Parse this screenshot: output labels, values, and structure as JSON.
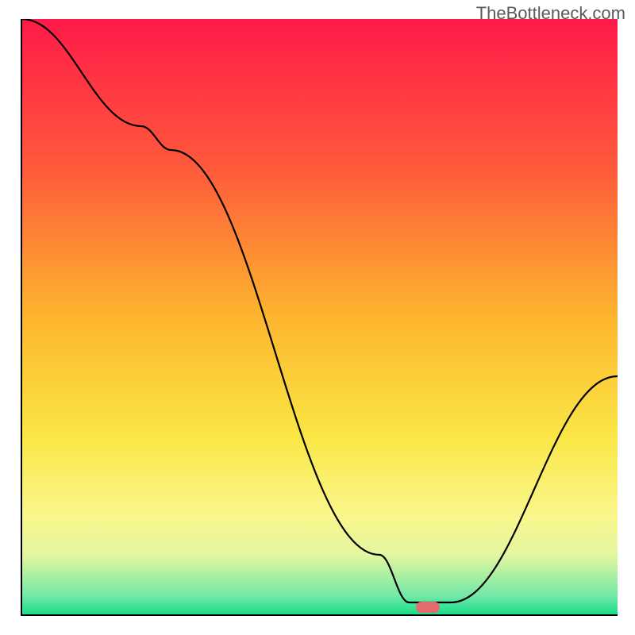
{
  "watermark": "TheBottleneck.com",
  "chart_data": {
    "type": "line",
    "title": "",
    "xlabel": "",
    "ylabel": "",
    "xlim": [
      0,
      100
    ],
    "ylim": [
      0,
      100
    ],
    "x": [
      0,
      20,
      25,
      60,
      65,
      72,
      100
    ],
    "values": [
      100,
      82,
      78,
      10,
      2,
      2,
      40
    ],
    "optimal_point": {
      "x": 68,
      "y": 1.5
    },
    "marker_color": "#e46a6e",
    "gradient_stops": [
      {
        "offset": 0,
        "color": "#ff1a49"
      },
      {
        "offset": 25,
        "color": "#ff5a3b"
      },
      {
        "offset": 50,
        "color": "#fdb52e"
      },
      {
        "offset": 70,
        "color": "#fae645"
      },
      {
        "offset": 83,
        "color": "#faf78a"
      },
      {
        "offset": 90,
        "color": "#e4f6a0"
      },
      {
        "offset": 97,
        "color": "#6fe8a7"
      },
      {
        "offset": 100,
        "color": "#19de8b"
      }
    ]
  }
}
